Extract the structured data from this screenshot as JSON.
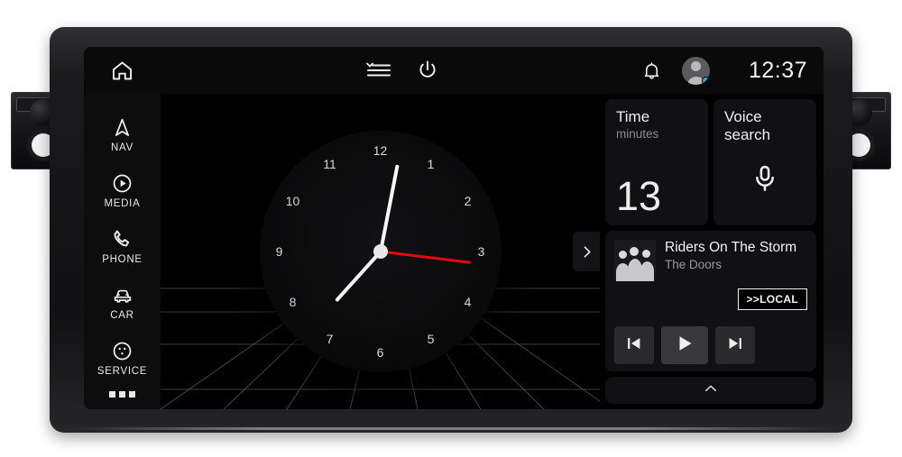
{
  "device": {
    "name": "car-head-unit"
  },
  "statusbar": {
    "home_icon": "home-icon",
    "menu_icon": "hamburger-menu-icon",
    "power_icon": "power-icon",
    "bell_icon": "notification-bell-icon",
    "avatar_icon": "user-avatar",
    "clock": "12:37",
    "status_dot_color": "#17b5c9"
  },
  "sidebar": {
    "items": [
      {
        "label": "NAV",
        "icon": "navigation-arrow-icon"
      },
      {
        "label": "MEDIA",
        "icon": "media-play-circle-icon"
      },
      {
        "label": "PHONE",
        "icon": "phone-handset-icon"
      },
      {
        "label": "CAR",
        "icon": "car-front-icon"
      },
      {
        "label": "SERVICE",
        "icon": "service-dots-circle-icon"
      }
    ],
    "more_icon": "more-apps-dots-icon"
  },
  "clock_widget": {
    "name": "analog-clock",
    "numerals": [
      "12",
      "1",
      "2",
      "3",
      "4",
      "5",
      "6",
      "7",
      "8",
      "9",
      "10",
      "11"
    ],
    "hour_angle": 222,
    "minute_angle": 11,
    "second_angle": 97,
    "second_hand_color": "#e40b0b"
  },
  "expand_button": {
    "icon": "chevron-right-icon"
  },
  "right_panel": {
    "time_widget": {
      "title": "Time",
      "subtitle": "minutes",
      "value": "13"
    },
    "voice_widget": {
      "title": "Voice search",
      "icon": "microphone-icon"
    },
    "media": {
      "track_title": "Riders On The Storm",
      "artist": "The Doors",
      "source_badge": ">>LOCAL",
      "album_art": "album-art-thumbnail",
      "controls": [
        {
          "name": "previous-track-button",
          "icon": "skip-previous-icon"
        },
        {
          "name": "play-button",
          "icon": "play-icon"
        },
        {
          "name": "next-track-button",
          "icon": "skip-next-icon"
        }
      ]
    },
    "drawer_handle_icon": "chevron-up-icon"
  }
}
